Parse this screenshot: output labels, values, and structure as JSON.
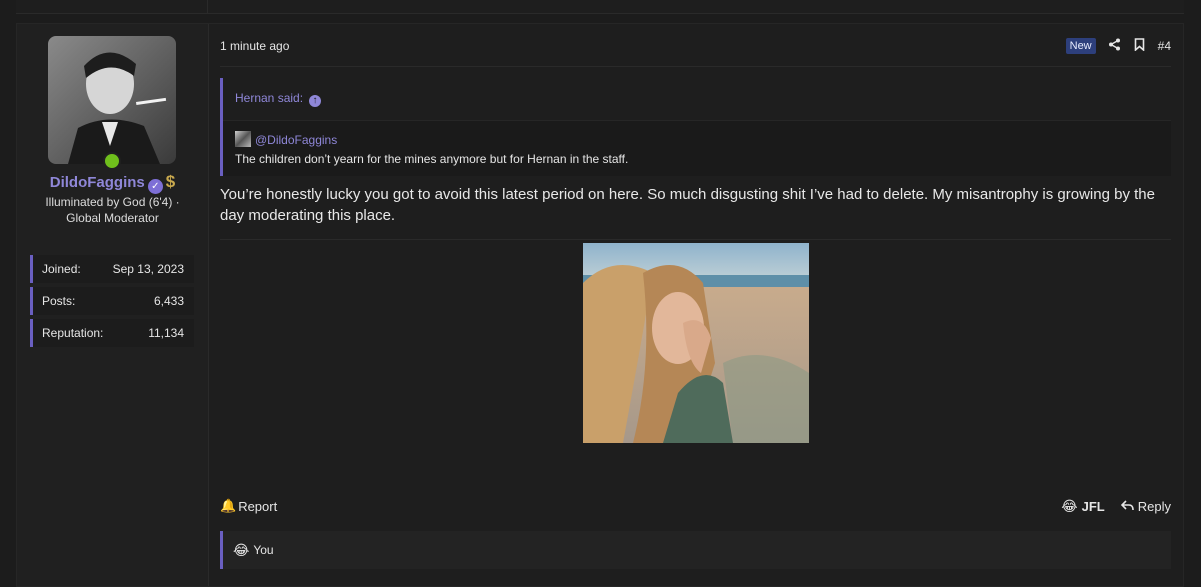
{
  "user": {
    "name": "DildoFaggins",
    "verified_symbol": "✓",
    "badge_symbol": "$",
    "title": "Illuminated by God (6'4) · Global Moderator",
    "online": true,
    "stats": [
      {
        "label": "Joined:",
        "value": "Sep 13, 2023"
      },
      {
        "label": "Posts:",
        "value": "6,433"
      },
      {
        "label": "Reputation:",
        "value": "11,134"
      }
    ]
  },
  "post": {
    "time": "1 minute ago",
    "new_badge": "New",
    "number": "#4",
    "quote": {
      "author_line": "Hernan said:",
      "mention": "@DildoFaggins",
      "text": "The children don’t yearn for the mines anymore but for Hernan in the staff."
    },
    "message": "You’re honestly lucky you got to avoid this latest period on here. So much disgusting shit I’ve had to delete. My misantrophy is growing by the day moderating this place."
  },
  "footer": {
    "report_label": "Report",
    "reaction_emoji": "😂",
    "reaction_label": "JFL",
    "reply_label": "Reply"
  },
  "reactions": {
    "emoji": "😂",
    "label": "You"
  },
  "colors": {
    "accent": "#8f87d8",
    "online": "#6fbf1c",
    "new_badge_bg": "#2d3f7c"
  }
}
